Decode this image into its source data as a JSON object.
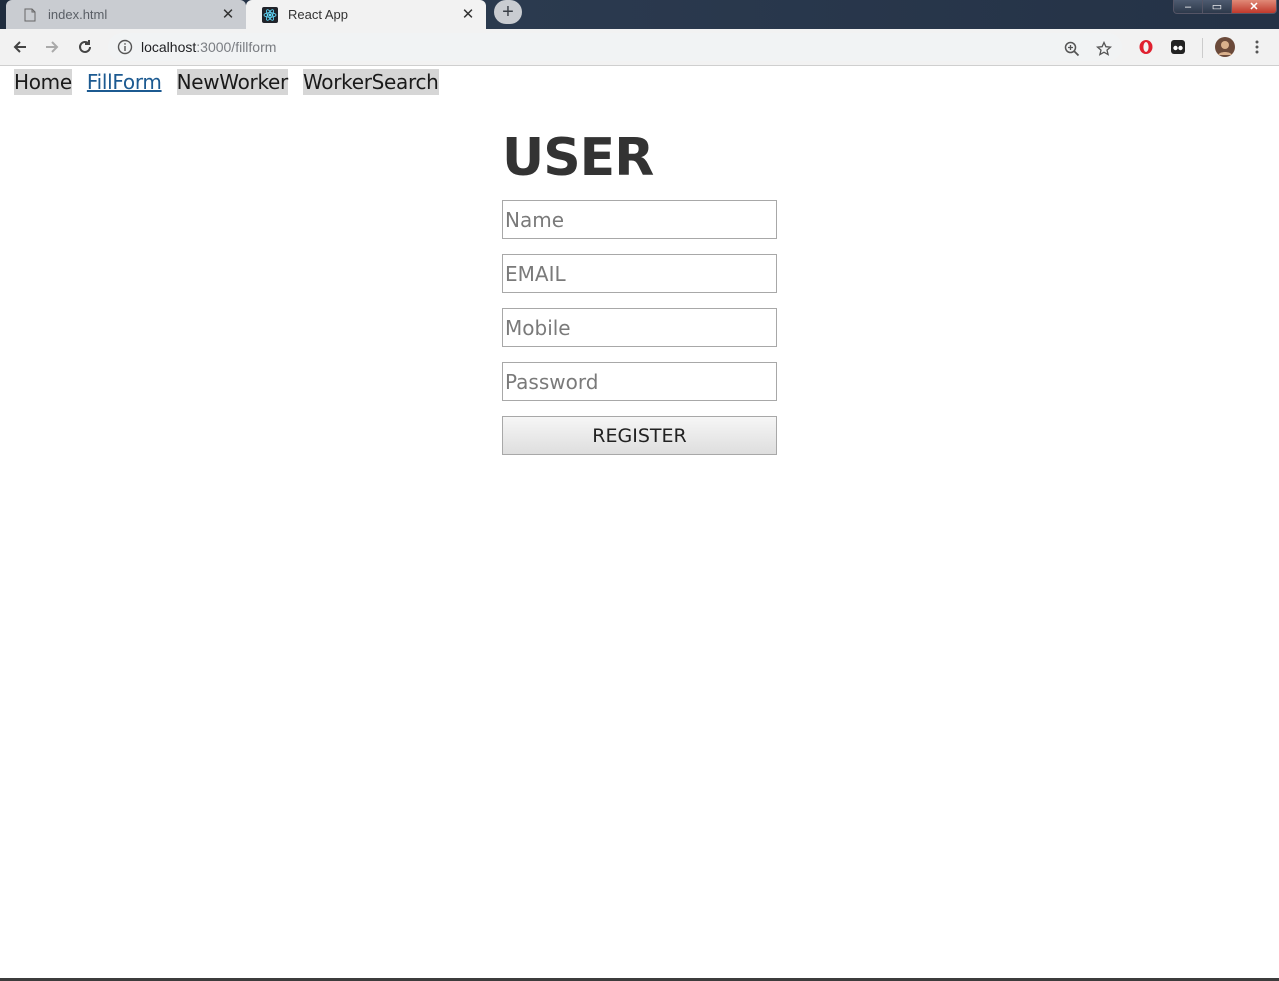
{
  "tabs": [
    {
      "label": "index.html",
      "icon": "file-icon",
      "active": false
    },
    {
      "label": "React App",
      "icon": "react-icon",
      "active": true
    }
  ],
  "window_controls": {
    "minimize": "–",
    "maximize": "▭",
    "close": "✕"
  },
  "toolbar": {
    "url_host": "localhost",
    "url_path": ":3000/fillform"
  },
  "nav": {
    "links": [
      "Home",
      "FillForm",
      "NewWorker",
      "WorkerSearch"
    ],
    "current": "FillForm"
  },
  "form": {
    "title": "USER",
    "name_placeholder": "Name",
    "email_placeholder": "EMAIL",
    "mobile_placeholder": "Mobile",
    "password_placeholder": "Password",
    "submit_label": "REGISTER"
  },
  "colors": {
    "nav_current": "#1c5a91",
    "nav_bg": "#d6d6d6",
    "title_text": "#333333"
  }
}
